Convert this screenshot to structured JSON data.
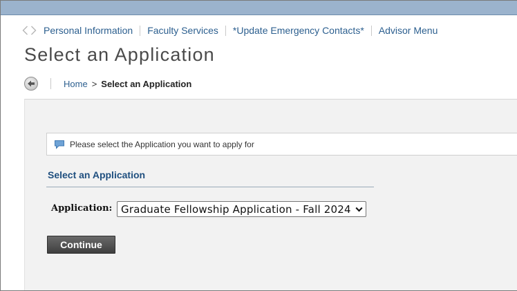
{
  "nav": {
    "links": [
      "Personal Information",
      "Faculty Services",
      "*Update Emergency Contacts*",
      "Advisor Menu"
    ]
  },
  "page": {
    "title": "Select an Application"
  },
  "breadcrumb": {
    "home": "Home",
    "separator": ">",
    "current": "Select an Application"
  },
  "info": {
    "message": "Please select the Application you want to apply for",
    "icon": "speech-bubble-icon"
  },
  "form": {
    "section_title": "Select an Application",
    "field_label": "Application:",
    "selected_value": "Graduate Fellowship Application - Fall 2024",
    "continue_label": "Continue"
  },
  "colors": {
    "top_bar": "#9bb3cd",
    "link": "#2c5f8f",
    "section_title": "#1f4f7f",
    "content_bg": "#f2f2f2",
    "button": "#4f4f4f"
  }
}
